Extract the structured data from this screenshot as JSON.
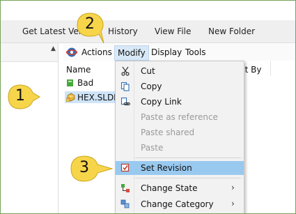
{
  "ribbon": {
    "get_latest": "Get Latest Versi",
    "history": "History",
    "view_file": "View File",
    "new_folder": "New Folder"
  },
  "menubar": {
    "actions": "Actions",
    "modify": "Modify",
    "display": "Display",
    "tools": "Tools"
  },
  "list": {
    "col_name": "Name",
    "col_out_by": "ut By",
    "rows": [
      "Bad",
      "HEX.SLDPF"
    ]
  },
  "context_menu": {
    "cut": "Cut",
    "copy": "Copy",
    "copy_link": "Copy Link",
    "paste_as_reference": "Paste as reference",
    "paste_shared": "Paste shared",
    "paste": "Paste",
    "set_revision": "Set Revision",
    "change_state": "Change State",
    "change_category": "Change Category"
  },
  "callouts": [
    "1",
    "2",
    "3"
  ],
  "colors": {
    "callout_fill": "#f7d54a",
    "highlight": "#99c9ef",
    "frame_border": "#74a25a"
  }
}
